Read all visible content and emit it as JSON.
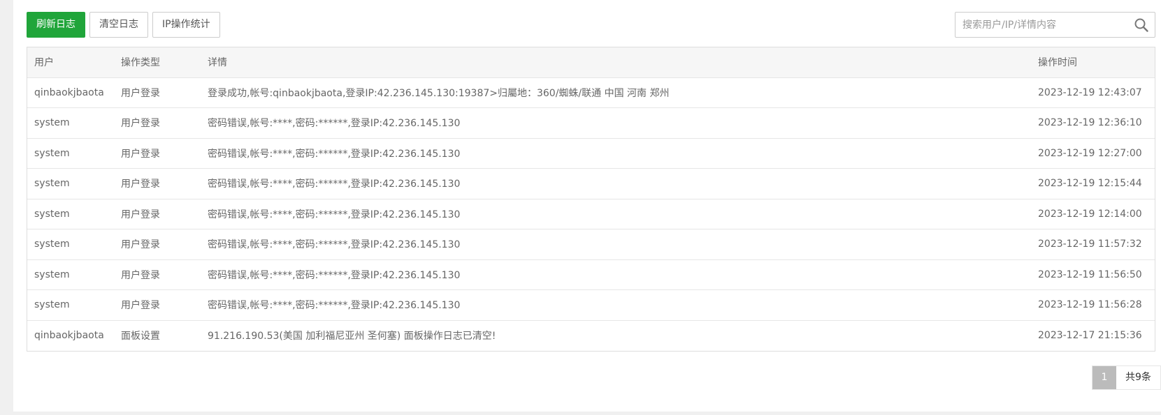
{
  "toolbar": {
    "refresh_label": "刷新日志",
    "clear_label": "清空日志",
    "ip_stats_label": "IP操作统计"
  },
  "search": {
    "placeholder": "搜索用户/IP/详情内容",
    "value": ""
  },
  "icons": {
    "search": "search-icon"
  },
  "colors": {
    "primary": "#20a53a",
    "header_bg": "#f6f6f6",
    "page_active_bg": "#bbbbbb"
  },
  "table": {
    "headers": {
      "user": "用户",
      "type": "操作类型",
      "detail": "详情",
      "time": "操作时间"
    },
    "rows": [
      {
        "user": "qinbaokjbaota",
        "type": "用户登录",
        "detail": "登录成功,帐号:qinbaokjbaota,登录IP:42.236.145.130:19387>归屬地：360/蜘蛛/联通 中国 河南 郑州",
        "time": "2023-12-19 12:43:07"
      },
      {
        "user": "system",
        "type": "用户登录",
        "detail": "密码错误,帐号:****,密码:******,登录IP:42.236.145.130",
        "time": "2023-12-19 12:36:10"
      },
      {
        "user": "system",
        "type": "用户登录",
        "detail": "密码错误,帐号:****,密码:******,登录IP:42.236.145.130",
        "time": "2023-12-19 12:27:00"
      },
      {
        "user": "system",
        "type": "用户登录",
        "detail": "密码错误,帐号:****,密码:******,登录IP:42.236.145.130",
        "time": "2023-12-19 12:15:44"
      },
      {
        "user": "system",
        "type": "用户登录",
        "detail": "密码错误,帐号:****,密码:******,登录IP:42.236.145.130",
        "time": "2023-12-19 12:14:00"
      },
      {
        "user": "system",
        "type": "用户登录",
        "detail": "密码错误,帐号:****,密码:******,登录IP:42.236.145.130",
        "time": "2023-12-19 11:57:32"
      },
      {
        "user": "system",
        "type": "用户登录",
        "detail": "密码错误,帐号:****,密码:******,登录IP:42.236.145.130",
        "time": "2023-12-19 11:56:50"
      },
      {
        "user": "system",
        "type": "用户登录",
        "detail": "密码错误,帐号:****,密码:******,登录IP:42.236.145.130",
        "time": "2023-12-19 11:56:28"
      },
      {
        "user": "qinbaokjbaota",
        "type": "面板设置",
        "detail": "91.216.190.53(美国 加利福尼亚州 圣何塞) 面板操作日志已清空!",
        "time": "2023-12-17 21:15:36"
      }
    ]
  },
  "pagination": {
    "current_page": "1",
    "total_label": "共9条"
  }
}
